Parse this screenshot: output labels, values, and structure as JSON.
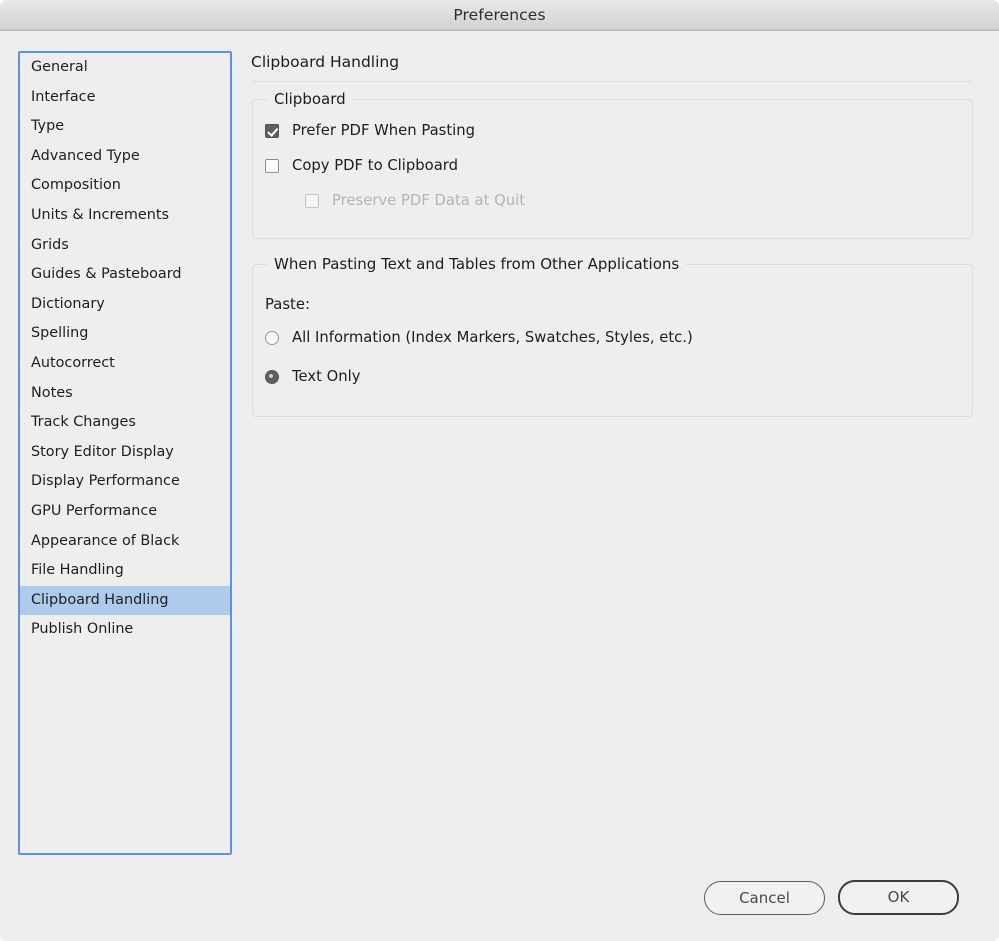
{
  "window": {
    "title": "Preferences",
    "accent_selection_color": "#aecbeb",
    "focus_ring_color": "#5e92e0",
    "background_color": "#efeeee"
  },
  "sidebar": {
    "items": [
      {
        "label": "General",
        "selected": false
      },
      {
        "label": "Interface",
        "selected": false
      },
      {
        "label": "Type",
        "selected": false
      },
      {
        "label": "Advanced Type",
        "selected": false
      },
      {
        "label": "Composition",
        "selected": false
      },
      {
        "label": "Units & Increments",
        "selected": false
      },
      {
        "label": "Grids",
        "selected": false
      },
      {
        "label": "Guides & Pasteboard",
        "selected": false
      },
      {
        "label": "Dictionary",
        "selected": false
      },
      {
        "label": "Spelling",
        "selected": false
      },
      {
        "label": "Autocorrect",
        "selected": false
      },
      {
        "label": "Notes",
        "selected": false
      },
      {
        "label": "Track Changes",
        "selected": false
      },
      {
        "label": "Story Editor Display",
        "selected": false
      },
      {
        "label": "Display Performance",
        "selected": false
      },
      {
        "label": "GPU Performance",
        "selected": false
      },
      {
        "label": "Appearance of Black",
        "selected": false
      },
      {
        "label": "File Handling",
        "selected": false
      },
      {
        "label": "Clipboard Handling",
        "selected": true
      },
      {
        "label": "Publish Online",
        "selected": false
      }
    ]
  },
  "pane": {
    "title": "Clipboard Handling",
    "clipboard_group": {
      "legend": "Clipboard",
      "options": [
        {
          "label": "Prefer PDF When Pasting",
          "checked": true,
          "disabled": false
        },
        {
          "label": "Copy PDF to Clipboard",
          "checked": false,
          "disabled": false
        },
        {
          "label": "Preserve PDF Data at Quit",
          "checked": false,
          "disabled": true
        }
      ]
    },
    "pasting_group": {
      "legend": "When Pasting Text and Tables from Other Applications",
      "paste_label": "Paste:",
      "options": [
        {
          "label": "All Information (Index Markers, Swatches, Styles, etc.)",
          "selected": false
        },
        {
          "label": "Text Only",
          "selected": true
        }
      ]
    }
  },
  "footer": {
    "cancel_label": "Cancel",
    "ok_label": "OK"
  }
}
